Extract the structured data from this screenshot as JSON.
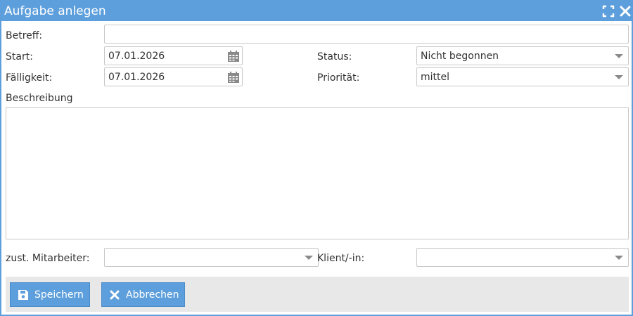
{
  "dialog": {
    "title": "Aufgabe anlegen",
    "icons": {
      "maximize": "maximize-icon",
      "close": "close-icon"
    }
  },
  "form": {
    "subject": {
      "label": "Betreff:",
      "value": ""
    },
    "start": {
      "label": "Start:",
      "value": "07.01.2026",
      "icon": "calendar-icon"
    },
    "due": {
      "label": "Fälligkeit:",
      "value": "07.01.2026",
      "icon": "calendar-icon"
    },
    "status": {
      "label": "Status:",
      "value": "Nicht begonnen"
    },
    "priority": {
      "label": "Priorität:",
      "value": "mittel"
    },
    "description": {
      "label": "Beschreibung",
      "value": ""
    },
    "coworkers": {
      "label": "zust. Mitarbeiter:",
      "value": ""
    },
    "client": {
      "label": "Klient/-in:",
      "value": ""
    }
  },
  "buttons": {
    "save": {
      "label": "Speichern",
      "icon": "save-icon"
    },
    "cancel": {
      "label": "Abbrechen",
      "icon": "close-icon"
    }
  },
  "colors": {
    "accent": "#5d9fdc",
    "footer": "#e8e8e8",
    "border": "#c8c8c8",
    "icon_gray": "#8a8a8a"
  }
}
